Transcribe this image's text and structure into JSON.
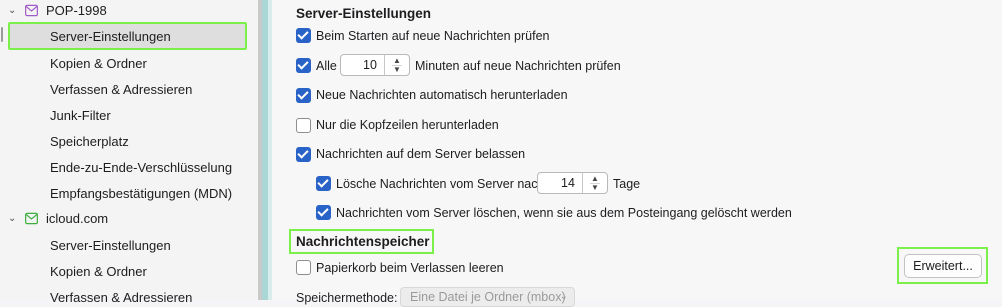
{
  "sidebar": {
    "accounts": [
      {
        "name": "POP-1998",
        "items": [
          "Server-Einstellungen",
          "Kopien & Ordner",
          "Verfassen & Adressieren",
          "Junk-Filter",
          "Speicherplatz",
          "Ende-zu-Ende-Verschlüsselung",
          "Empfangsbestätigungen (MDN)"
        ]
      },
      {
        "name": "icloud.com",
        "items": [
          "Server-Einstellungen",
          "Kopien & Ordner",
          "Verfassen & Adressieren"
        ]
      }
    ]
  },
  "main": {
    "section_title": "Server-Einstellungen",
    "check_on_start": "Beim Starten auf neue Nachrichten prüfen",
    "check_every_prefix": "Alle",
    "check_every_value": "10",
    "check_every_suffix": "Minuten auf neue Nachrichten prüfen",
    "auto_download": "Neue Nachrichten automatisch herunterladen",
    "headers_only": "Nur die Kopfzeilen herunterladen",
    "leave_on_server": "Nachrichten auf dem Server belassen",
    "delete_after_prefix": "Lösche Nachrichten vom Server nach",
    "delete_after_value": "14",
    "delete_after_suffix": "Tage",
    "delete_when_removed": "Nachrichten vom Server löschen, wenn sie aus dem Posteingang gelöscht werden",
    "storage_title": "Nachrichtenspeicher",
    "empty_trash": "Papierkorb beim Verlassen leeren",
    "advanced_button": "Erweitert...",
    "storage_method_label": "Speichermethode:",
    "storage_method_value": "Eine Datei je Ordner (mbox)"
  },
  "colors": {
    "checkbox_accent": "#2a63c8",
    "highlight": "#7cf04a"
  }
}
